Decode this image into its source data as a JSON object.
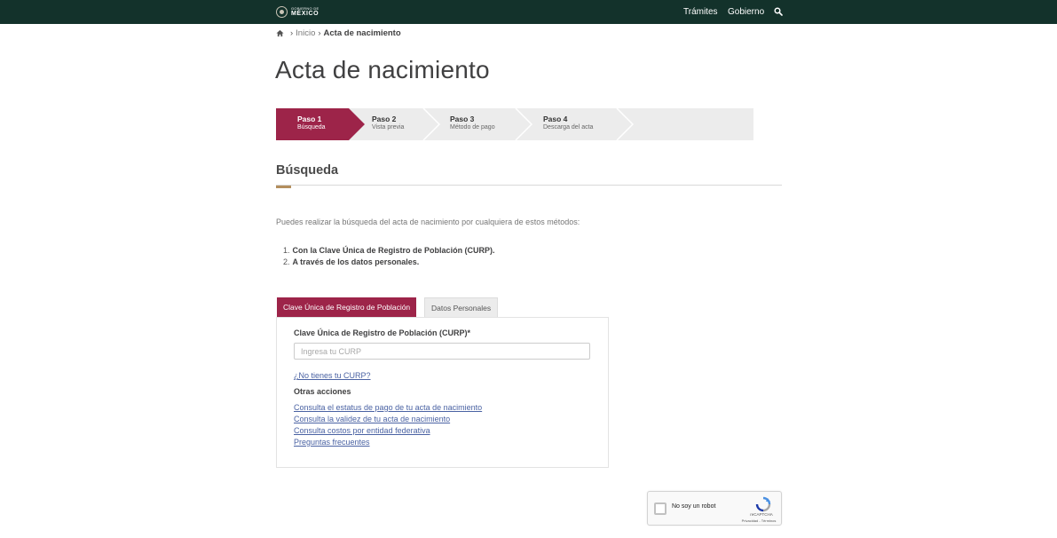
{
  "header": {
    "logo_small": "GOBIERNO DE",
    "logo_big": "MÉXICO",
    "nav": [
      "Trámites",
      "Gobierno"
    ],
    "search_icon": "search-icon"
  },
  "breadcrumb": {
    "home_icon": "home-icon",
    "items": [
      "Inicio",
      "Acta de nacimiento"
    ]
  },
  "page": {
    "title": "Acta de nacimiento"
  },
  "steps": [
    {
      "label": "Paso 1",
      "sub": "Búsqueda"
    },
    {
      "label": "Paso 2",
      "sub": "Vista previa"
    },
    {
      "label": "Paso 3",
      "sub": "Método de pago"
    },
    {
      "label": "Paso 4",
      "sub": "Descarga del acta"
    }
  ],
  "section": {
    "title": "Búsqueda",
    "intro": "Puedes realizar la búsqueda del acta de nacimiento por cualquiera de estos métodos:",
    "methods": [
      {
        "num": "1.",
        "text": "Con la Clave Única de Registro de Población (CURP)."
      },
      {
        "num": "2.",
        "text": "A través de los datos personales."
      }
    ]
  },
  "tabs": [
    "Clave Única de Registro de Población",
    "Datos Personales"
  ],
  "form": {
    "curp_label": "Clave Única de Registro de Población (CURP)*",
    "curp_placeholder": "Ingresa tu CURP",
    "curp_value": "",
    "no_curp_link": "¿No tienes tu CURP?",
    "other_actions_title": "Otras acciones",
    "actions": [
      "Consulta el estatus de pago de tu acta de nacimiento",
      "Consulta la validez de tu acta de nacimiento",
      "Consulta costos por entidad federativa",
      "Preguntas frecuentes"
    ]
  },
  "recaptcha": {
    "label": "No soy un robot",
    "brand": "reCAPTCHA",
    "terms": "Privacidad - Términos"
  },
  "colors": {
    "header_bg": "#13322b",
    "accent": "#9d2449",
    "gold": "#b38e5d",
    "link": "#4a62a3"
  }
}
